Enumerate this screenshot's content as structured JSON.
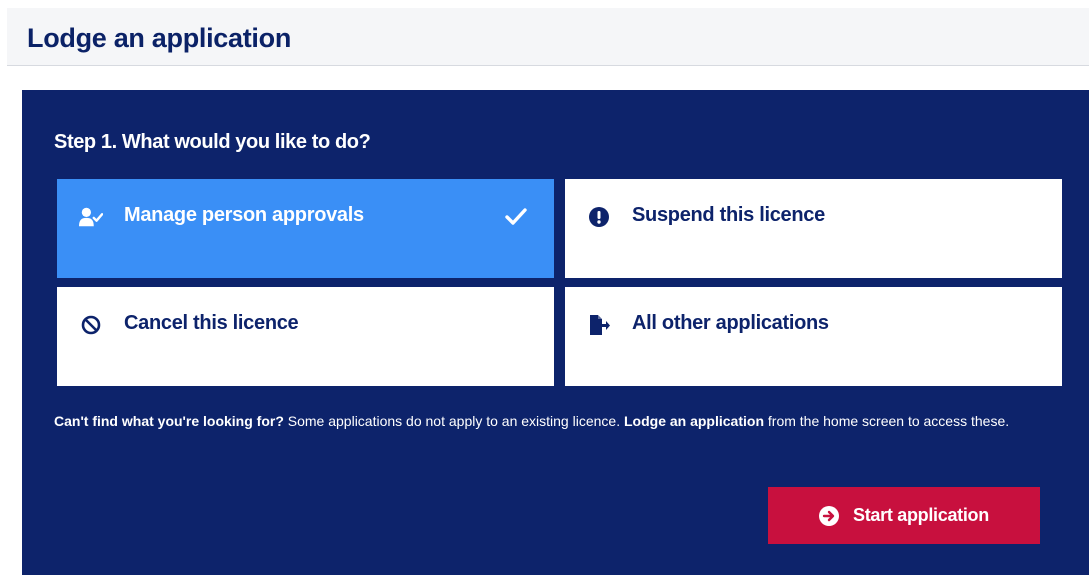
{
  "header": {
    "title": "Lodge an application"
  },
  "step": {
    "title": "Step 1. What would you like to do?"
  },
  "options": [
    {
      "label": "Manage person approvals",
      "icon": "user-check-icon",
      "selected": true
    },
    {
      "label": "Suspend this licence",
      "icon": "exclamation-circle-icon",
      "selected": false
    },
    {
      "label": "Cancel this licence",
      "icon": "ban-icon",
      "selected": false
    },
    {
      "label": "All other applications",
      "icon": "file-export-icon",
      "selected": false
    }
  ],
  "help": {
    "lead": "Can't find what you're looking for?",
    "text1": " Some applications do not apply to an existing licence. ",
    "link": "Lodge an application",
    "text2": " from the home screen to access these."
  },
  "actions": {
    "start_label": "Start application",
    "start_icon": "arrow-circle-right-icon"
  },
  "colors": {
    "panel": "#0d236b",
    "selected": "#3a8ff6",
    "primary_button": "#c8103e",
    "title": "#0b2267"
  }
}
